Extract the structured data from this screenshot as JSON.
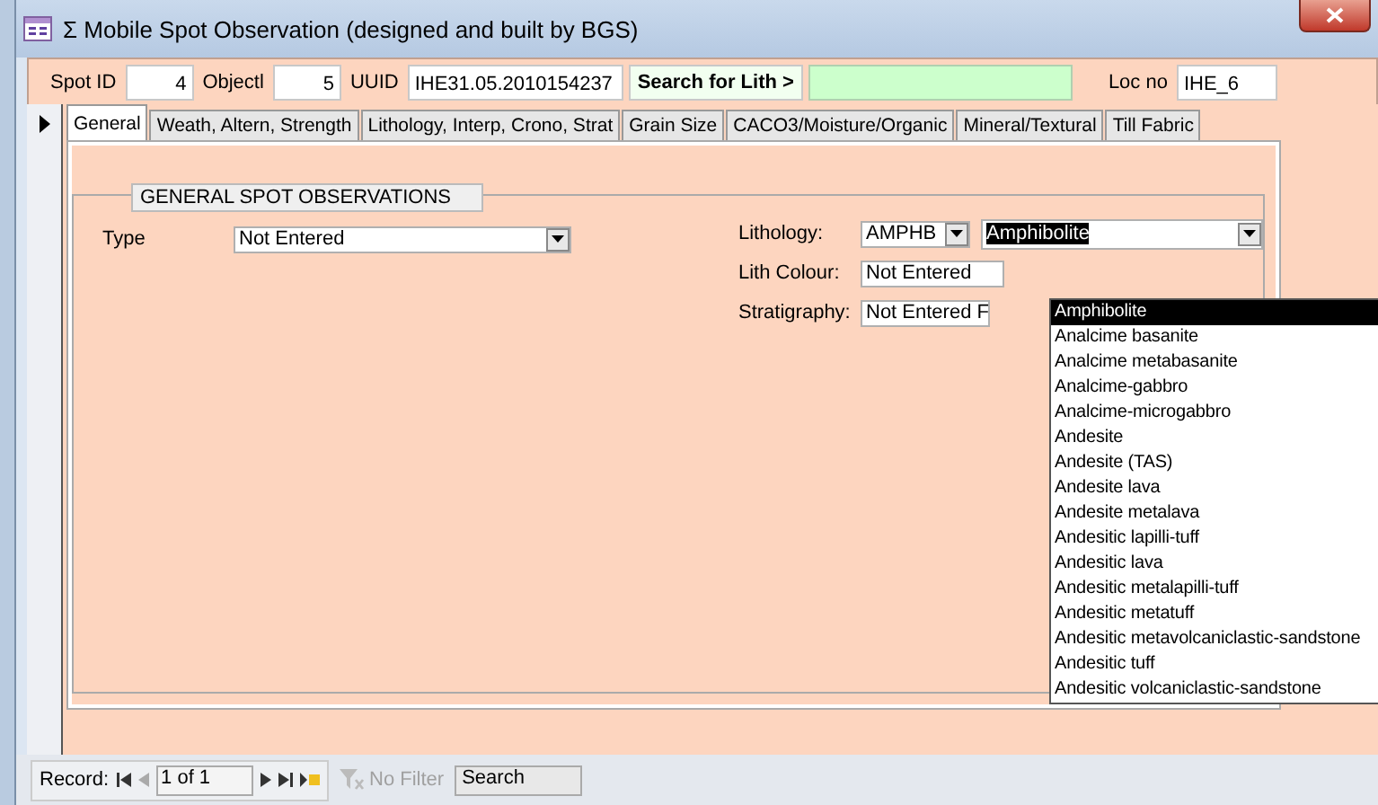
{
  "window": {
    "title": "Σ Mobile Spot Observation (designed and built by BGS)"
  },
  "header": {
    "fields": [
      {
        "kind": "number",
        "label": "Spot ID",
        "value": "4"
      },
      {
        "kind": "number",
        "label": "Objectl",
        "value": "5"
      },
      {
        "kind": "field",
        "label": "UUID",
        "value": "IHE31.05.2010154237"
      },
      {
        "kind": "search",
        "label": "Search for Lith >"
      },
      {
        "kind": "field",
        "label": "Loc no",
        "value": "IHE_6"
      }
    ]
  },
  "tabs": [
    {
      "label": "General",
      "selected": true
    },
    {
      "label": "Weath, Altern, Strength",
      "selected": false
    },
    {
      "label": "Lithology, Interp, Crono, Strat",
      "selected": false
    },
    {
      "label": "Grain Size",
      "selected": false
    },
    {
      "label": "CACO3/Moisture/Organic",
      "selected": false
    },
    {
      "label": "Mineral/Textural",
      "selected": false
    },
    {
      "label": "Till Fabric",
      "selected": false
    }
  ],
  "group": {
    "title": "GENERAL SPOT OBSERVATIONS",
    "type": {
      "label": "Type",
      "value": "Not Entered"
    },
    "lithology": {
      "label": "Lithology:",
      "code": "AMPHB",
      "name": "Amphibolite"
    },
    "lith_colour": {
      "label": "Lith Colour:",
      "value": "Not Entered"
    },
    "stratigraphy": {
      "label": "Stratigraphy:",
      "value": "Not Entered F"
    }
  },
  "dropdown": {
    "items": [
      {
        "label": "Amphibolite",
        "selected": true
      },
      {
        "label": "Analcime basanite",
        "selected": false
      },
      {
        "label": "Analcime metabasanite",
        "selected": false
      },
      {
        "label": "Analcime-gabbro",
        "selected": false
      },
      {
        "label": "Analcime-microgabbro",
        "selected": false
      },
      {
        "label": "Andesite",
        "selected": false
      },
      {
        "label": "Andesite (TAS)",
        "selected": false
      },
      {
        "label": "Andesite lava",
        "selected": false
      },
      {
        "label": "Andesite metalava",
        "selected": false
      },
      {
        "label": "Andesitic lapilli-tuff",
        "selected": false
      },
      {
        "label": "Andesitic lava",
        "selected": false
      },
      {
        "label": "Andesitic metalapilli-tuff",
        "selected": false
      },
      {
        "label": "Andesitic metatuff",
        "selected": false
      },
      {
        "label": "Andesitic metavolcaniclastic-sandstone",
        "selected": false
      },
      {
        "label": "Andesitic tuff",
        "selected": false
      },
      {
        "label": "Andesitic volcaniclastic-sandstone",
        "selected": false
      }
    ]
  },
  "record_nav": {
    "label": "Record:",
    "position": "1 of 1",
    "filter": {
      "label": "No Filter",
      "disabled": true
    },
    "search": "Search"
  }
}
